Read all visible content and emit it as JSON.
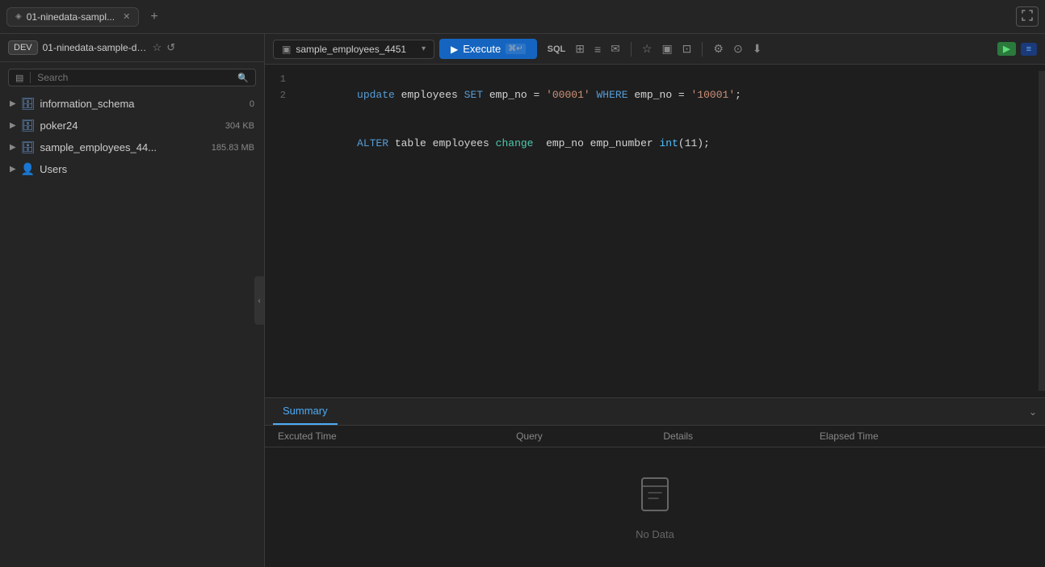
{
  "titlebar": {
    "tab_label": "01-ninedata-sampl...",
    "tab_icon": "◈",
    "add_tab": "+",
    "fullscreen": "⛶"
  },
  "sidebar": {
    "badge_label": "DEV",
    "breadcrumb": "01-ninedata-sample-data...",
    "search_placeholder": "Search",
    "filter_icon": "▤",
    "items": [
      {
        "label": "information_schema",
        "count": "0",
        "type": "folder"
      },
      {
        "label": "poker24",
        "size": "304 KB",
        "type": "folder"
      },
      {
        "label": "sample_employees_44...",
        "size": "185.83 MB",
        "type": "folder"
      },
      {
        "label": "Users",
        "type": "user"
      }
    ]
  },
  "toolbar": {
    "db_name": "sample_employees_4451",
    "execute_label": "Execute",
    "execute_shortcut": "⌘↵",
    "icons": [
      "SQL",
      "⊞",
      "⊟",
      "✉",
      "☆",
      "▣",
      "⊡",
      "⚙",
      "⊙",
      "⬇"
    ]
  },
  "editor": {
    "lines": [
      {
        "number": "1",
        "tokens": [
          {
            "text": "update",
            "class": "kw-blue"
          },
          {
            "text": " employees ",
            "class": "kw-white"
          },
          {
            "text": "SET",
            "class": "kw-blue"
          },
          {
            "text": " emp_no = ",
            "class": "kw-white"
          },
          {
            "text": "'00001'",
            "class": "str-val"
          },
          {
            "text": " WHERE",
            "class": "kw-blue"
          },
          {
            "text": " emp_no = ",
            "class": "kw-white"
          },
          {
            "text": "'10001'",
            "class": "str-val"
          },
          {
            "text": ";",
            "class": "kw-white"
          }
        ]
      },
      {
        "number": "2",
        "tokens": [
          {
            "text": "ALTER",
            "class": "kw-blue"
          },
          {
            "text": " table ",
            "class": "kw-white"
          },
          {
            "text": "employees",
            "class": "kw-white"
          },
          {
            "text": " change",
            "class": "kw-cyan"
          },
          {
            "text": "  emp_no emp_number ",
            "class": "kw-white"
          },
          {
            "text": "int",
            "class": "kw-type"
          },
          {
            "text": "(11);",
            "class": "kw-white"
          }
        ]
      }
    ]
  },
  "bottom": {
    "tabs": [
      "Summary"
    ],
    "active_tab": "Summary",
    "columns": [
      "Excuted Time",
      "Query",
      "Details",
      "Elapsed Time"
    ],
    "no_data_text": "No Data",
    "chevron_icon": "⌄"
  }
}
